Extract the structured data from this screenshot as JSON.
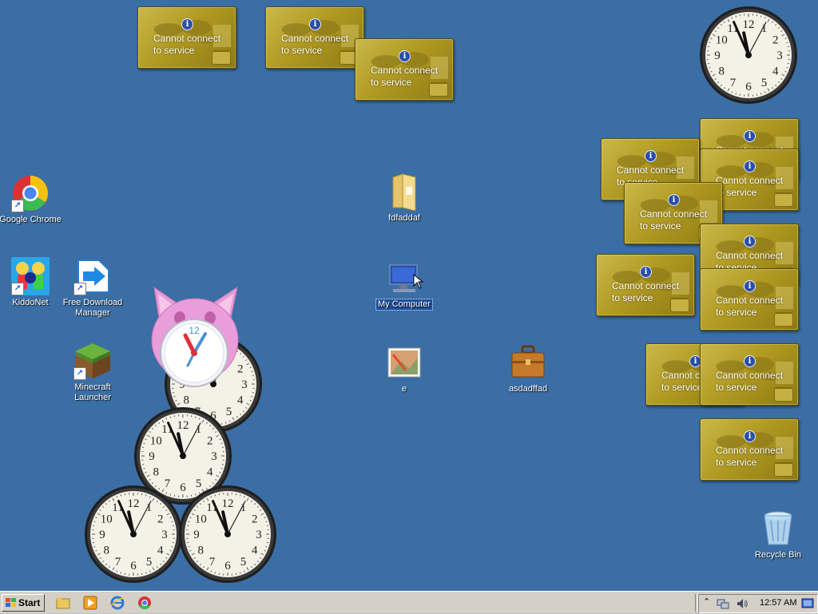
{
  "desktop": {
    "icons": {
      "chrome": "Google Chrome",
      "kiddonet": "KiddoNet",
      "fdm": "Free Download Manager",
      "minecraft": "Minecraft Launcher",
      "folder": "fdfaddaf",
      "mycomputer": "My Computer",
      "image_e": "e",
      "briefcase": "asdadffad",
      "recycle": "Recycle Bin"
    },
    "gadget_message_line1": "Cannot connect",
    "gadget_message_line2": "to service"
  },
  "taskbar": {
    "start_label": "Start",
    "time": "12:57 AM"
  },
  "colors": {
    "desktop_bg": "#3a6ea5",
    "taskbar_bg": "#d4d0c8",
    "gadget_gold": "#b09a22"
  }
}
